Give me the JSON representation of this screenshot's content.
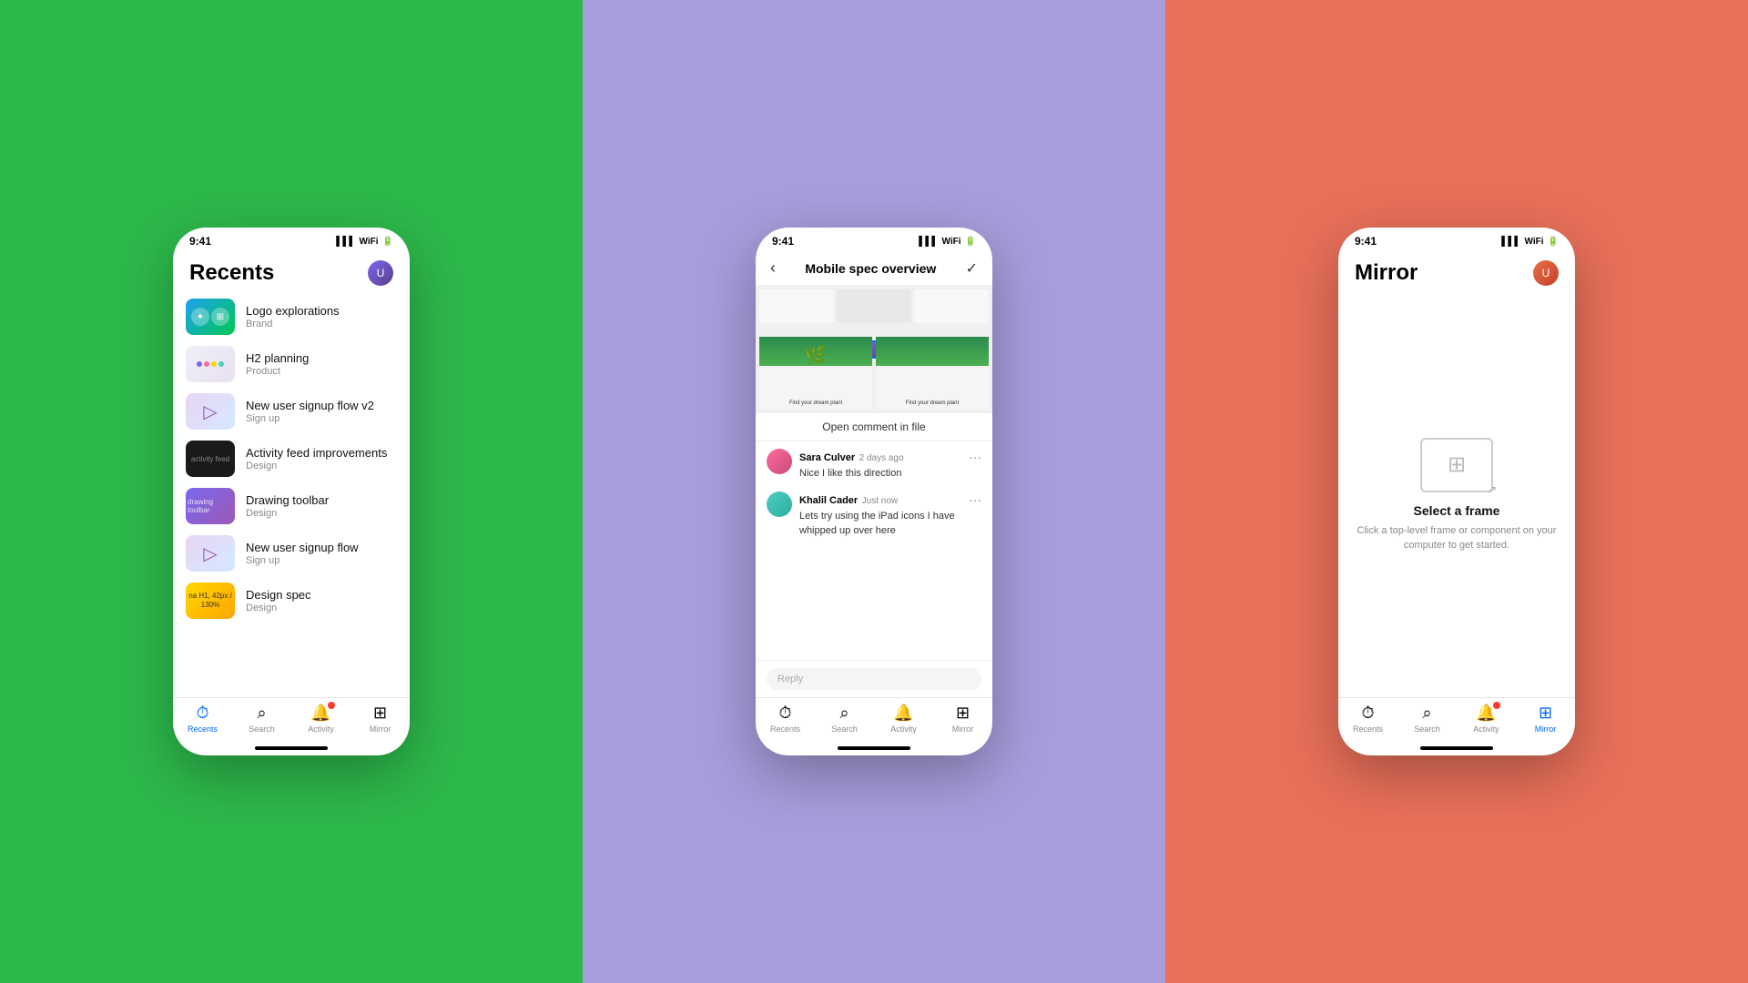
{
  "panels": [
    {
      "id": "green",
      "color": "#2DB84B"
    },
    {
      "id": "purple",
      "color": "#A89CDB"
    },
    {
      "id": "coral",
      "color": "#E8705A"
    }
  ],
  "phone1": {
    "statusTime": "9:41",
    "title": "Recents",
    "recents": [
      {
        "name": "Logo explorations",
        "sub": "Brand",
        "thumbType": "logo"
      },
      {
        "name": "H2 planning",
        "sub": "Product",
        "thumbType": "h2"
      },
      {
        "name": "New user signup flow v2",
        "sub": "Sign up",
        "thumbType": "signup"
      },
      {
        "name": "Activity feed improvements",
        "sub": "Design",
        "thumbType": "activity"
      },
      {
        "name": "Drawing toolbar",
        "sub": "Design",
        "thumbType": "drawing"
      },
      {
        "name": "New user signup flow",
        "sub": "Sign up",
        "thumbType": "signup2"
      },
      {
        "name": "Design spec",
        "sub": "Design",
        "thumbType": "designspec"
      }
    ],
    "nav": [
      {
        "label": "Recents",
        "active": true
      },
      {
        "label": "Search",
        "active": false
      },
      {
        "label": "Activity",
        "active": false,
        "badge": true
      },
      {
        "label": "Mirror",
        "active": false
      }
    ]
  },
  "phone2": {
    "statusTime": "9:41",
    "title": "Mobile spec overview",
    "openCommentLabel": "Open comment in file",
    "comments": [
      {
        "author": "Sara Culver",
        "time": "2 days ago",
        "text": "Nice I like this direction",
        "avatarType": "sara"
      },
      {
        "author": "Khalil Cader",
        "time": "Just now",
        "text": "Lets try using the iPad icons I have whipped up over here",
        "avatarType": "khalil"
      }
    ],
    "replyPlaceholder": "Reply",
    "nav": [
      {
        "label": "Recents",
        "active": false
      },
      {
        "label": "Search",
        "active": false
      },
      {
        "label": "Activity",
        "active": false
      },
      {
        "label": "Mirror",
        "active": false
      }
    ]
  },
  "phone3": {
    "statusTime": "9:41",
    "title": "Mirror",
    "selectFrameLabel": "Select a frame",
    "selectFrameDesc": "Click a top-level frame or component on your computer to get started.",
    "nav": [
      {
        "label": "Recents",
        "active": false
      },
      {
        "label": "Search",
        "active": false
      },
      {
        "label": "Activity",
        "active": false,
        "badge": true
      },
      {
        "label": "Mirror",
        "active": true
      }
    ]
  },
  "icons": {
    "recents": "⏱",
    "search": "🔍",
    "activity": "🔔",
    "mirror": "⊞",
    "back": "‹",
    "check": "✓",
    "more": "•••"
  }
}
